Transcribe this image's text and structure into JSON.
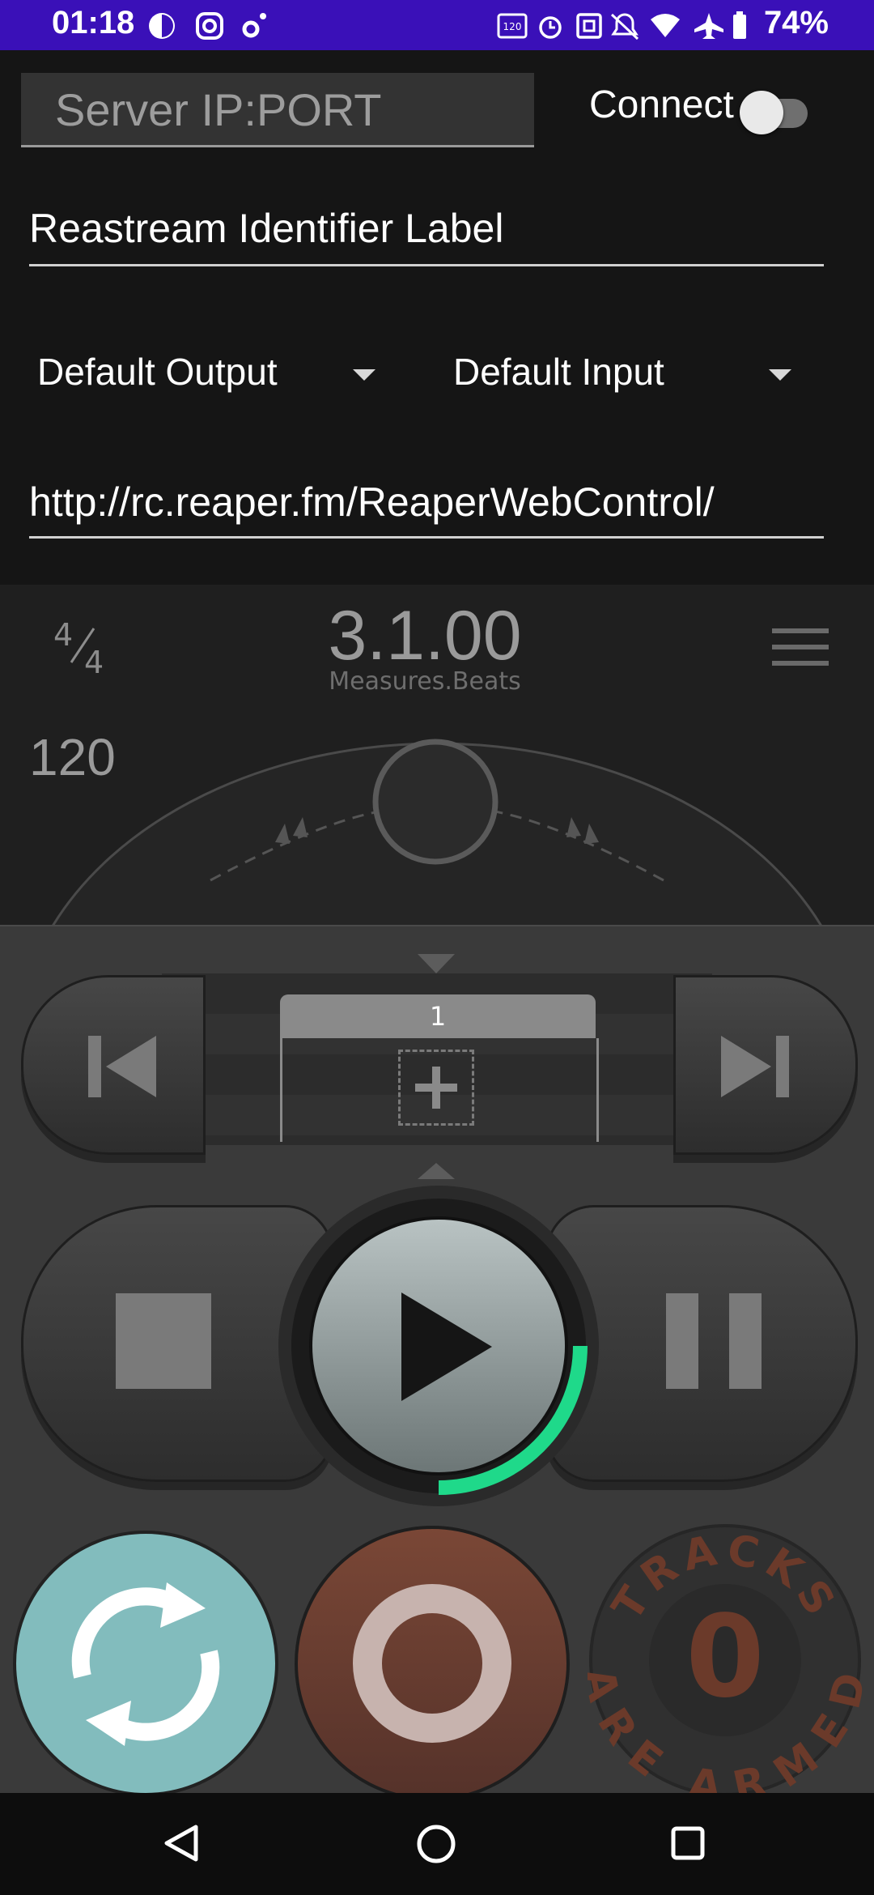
{
  "status_bar": {
    "time": "01:18",
    "battery_percent": "74%",
    "icons": [
      "privacy-icon",
      "instagram-icon",
      "gear-sparkle-icon",
      "120hz-icon",
      "alarm-icon",
      "nfc-icon",
      "bell-off-icon",
      "wifi-icon",
      "airplane-icon",
      "battery-icon"
    ]
  },
  "form": {
    "server_placeholder": "Server IP:PORT",
    "connect_label": "Connect",
    "connect_on": false,
    "identifier_value": "Reastream Identifier Label",
    "output_select": "Default Output",
    "input_select": "Default Input",
    "url_value": "http://rc.reaper.fm/ReaperWebControl/"
  },
  "transport": {
    "time_sig_top": "4",
    "time_sig_bottom": "4",
    "position": "3.1.00",
    "position_unit": "Measures.Beats",
    "tempo": "120",
    "marker_label": "1",
    "play_progress": 0.3,
    "tracks_armed_count": "0",
    "tracks_armed_top": "TRACKS",
    "tracks_armed_bottom": "ARE ARMED"
  },
  "colors": {
    "status_bar": "#3A10B8",
    "progress_green": "#1FD98A",
    "repeat_teal": "#82BCBD",
    "record_brown": "#6B3E30",
    "armed_text": "#6B3A2A"
  }
}
